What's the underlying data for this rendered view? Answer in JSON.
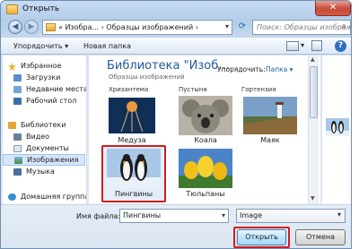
{
  "window": {
    "title": "Открыть"
  },
  "address": {
    "path": "« Изобра... › Образцы изображений ›"
  },
  "search": {
    "placeholder": "Поиск: Образцы изображений"
  },
  "toolbar": {
    "organize": "Упорядочить ▾",
    "new_folder": "Новая папка"
  },
  "nav": {
    "favorites": "Избранное",
    "downloads": "Загрузки",
    "recent": "Недавние места",
    "desktop": "Рабочий стол",
    "libraries": "Библиотеки",
    "video": "Видео",
    "documents": "Документы",
    "images": "Изображения",
    "music": "Музыка",
    "homegroup": "Домашняя группа"
  },
  "library": {
    "title": "Библиотека \"Изоб...",
    "subtitle": "Образцы изображений",
    "arrange_label": "Упорядочить:",
    "arrange_value": "Папка ▾"
  },
  "truncated": [
    "Хризантема",
    "Пустыня",
    "Гортензия"
  ],
  "thumbs": [
    {
      "caption": "Медуза"
    },
    {
      "caption": "Коала"
    },
    {
      "caption": "Маяк"
    },
    {
      "caption": "Пингвины"
    },
    {
      "caption": "Тюльпаны"
    }
  ],
  "filename": {
    "label": "Имя файла:",
    "value": "Пингвины"
  },
  "filetype": {
    "value": "Image"
  },
  "buttons": {
    "open": "Открыть",
    "cancel": "Отмена"
  },
  "colors": {
    "accent": "#1d5a9e",
    "highlight": "#d41c1c"
  }
}
